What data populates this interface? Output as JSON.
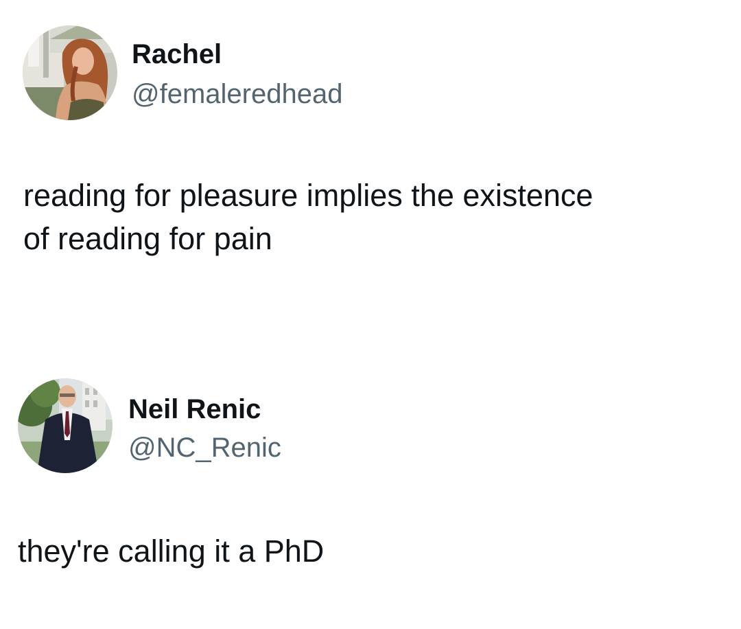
{
  "tweets": [
    {
      "author": {
        "name": "Rachel",
        "handle": "@femaleredhead",
        "avatar_icon": "profile-photo-redhead-woman"
      },
      "text_lines": [
        "reading for pleasure implies the existence",
        "of reading for pain"
      ]
    },
    {
      "author": {
        "name": "Neil Renic",
        "handle": "@NC_Renic",
        "avatar_icon": "profile-photo-man-in-suit"
      },
      "text_lines": [
        "they're calling it a PhD"
      ]
    }
  ],
  "colors": {
    "name_text": "#0f1419",
    "handle_text": "#536471",
    "background": "#ffffff"
  }
}
